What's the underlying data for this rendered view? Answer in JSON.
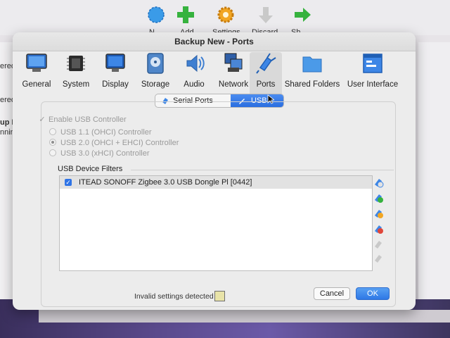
{
  "background": {
    "left_fragments": [
      "ered",
      "ered",
      "up New",
      "nning"
    ],
    "toolbar_fragments": [
      "N",
      "Add",
      "Settings",
      "Discard",
      "Sh"
    ]
  },
  "dialog": {
    "title": "Backup New - Ports",
    "categories": [
      {
        "label": "General",
        "icon": "general-monitor-icon"
      },
      {
        "label": "System",
        "icon": "chip-icon"
      },
      {
        "label": "Display",
        "icon": "display-monitor-icon"
      },
      {
        "label": "Storage",
        "icon": "hard-disk-icon"
      },
      {
        "label": "Audio",
        "icon": "speaker-icon"
      },
      {
        "label": "Network",
        "icon": "network-icon"
      },
      {
        "label": "Ports",
        "icon": "ports-plug-icon"
      },
      {
        "label": "Shared Folders",
        "icon": "folder-icon"
      },
      {
        "label": "User Interface",
        "icon": "window-icon"
      }
    ],
    "selected_category": "Ports",
    "tabs": [
      {
        "label": "Serial Ports",
        "icon": "serial-port-icon"
      },
      {
        "label": "USB",
        "icon": "usb-icon"
      }
    ],
    "selected_tab": "USB",
    "usb": {
      "enable_label": "Enable USB Controller",
      "options": [
        "USB 1.1 (OHCI) Controller",
        "USB 2.0 (OHCI + EHCI) Controller",
        "USB 3.0 (xHCI) Controller"
      ],
      "selected_option": "USB 2.0 (OHCI + EHCI) Controller",
      "filters_label": "USB Device Filters",
      "filters": [
        {
          "checked": true,
          "name": "ITEAD SONOFF Zigbee 3.0 USB Dongle Pl [0442]"
        }
      ]
    },
    "status_text": "Invalid settings detected",
    "buttons": {
      "cancel": "Cancel",
      "ok": "OK"
    },
    "colors": {
      "accent": "#2f74e6",
      "panel_bg": "#ececec"
    }
  }
}
